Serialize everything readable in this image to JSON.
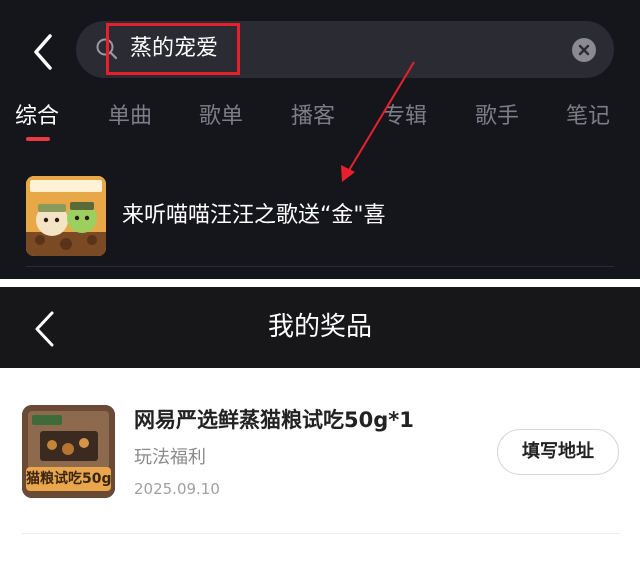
{
  "search_screen": {
    "query": "蒸的宠爱",
    "tabs": [
      {
        "label": "综合",
        "active": true
      },
      {
        "label": "单曲",
        "active": false
      },
      {
        "label": "歌单",
        "active": false
      },
      {
        "label": "播客",
        "active": false
      },
      {
        "label": "专辑",
        "active": false
      },
      {
        "label": "歌手",
        "active": false
      },
      {
        "label": "笔记",
        "active": false
      }
    ],
    "result": {
      "title": "来听喵喵汪汪之歌送“金\"喜"
    },
    "accent_color": "#e8202e"
  },
  "prize_screen": {
    "title": "我的奖品",
    "items": [
      {
        "name": "网易严选鲜蒸猫粮试吃50g*1",
        "subtitle": "玩法福利",
        "date": "2025.09.10",
        "action_label": "填写地址",
        "thumb_label": "猫粮试吃50g"
      }
    ]
  }
}
